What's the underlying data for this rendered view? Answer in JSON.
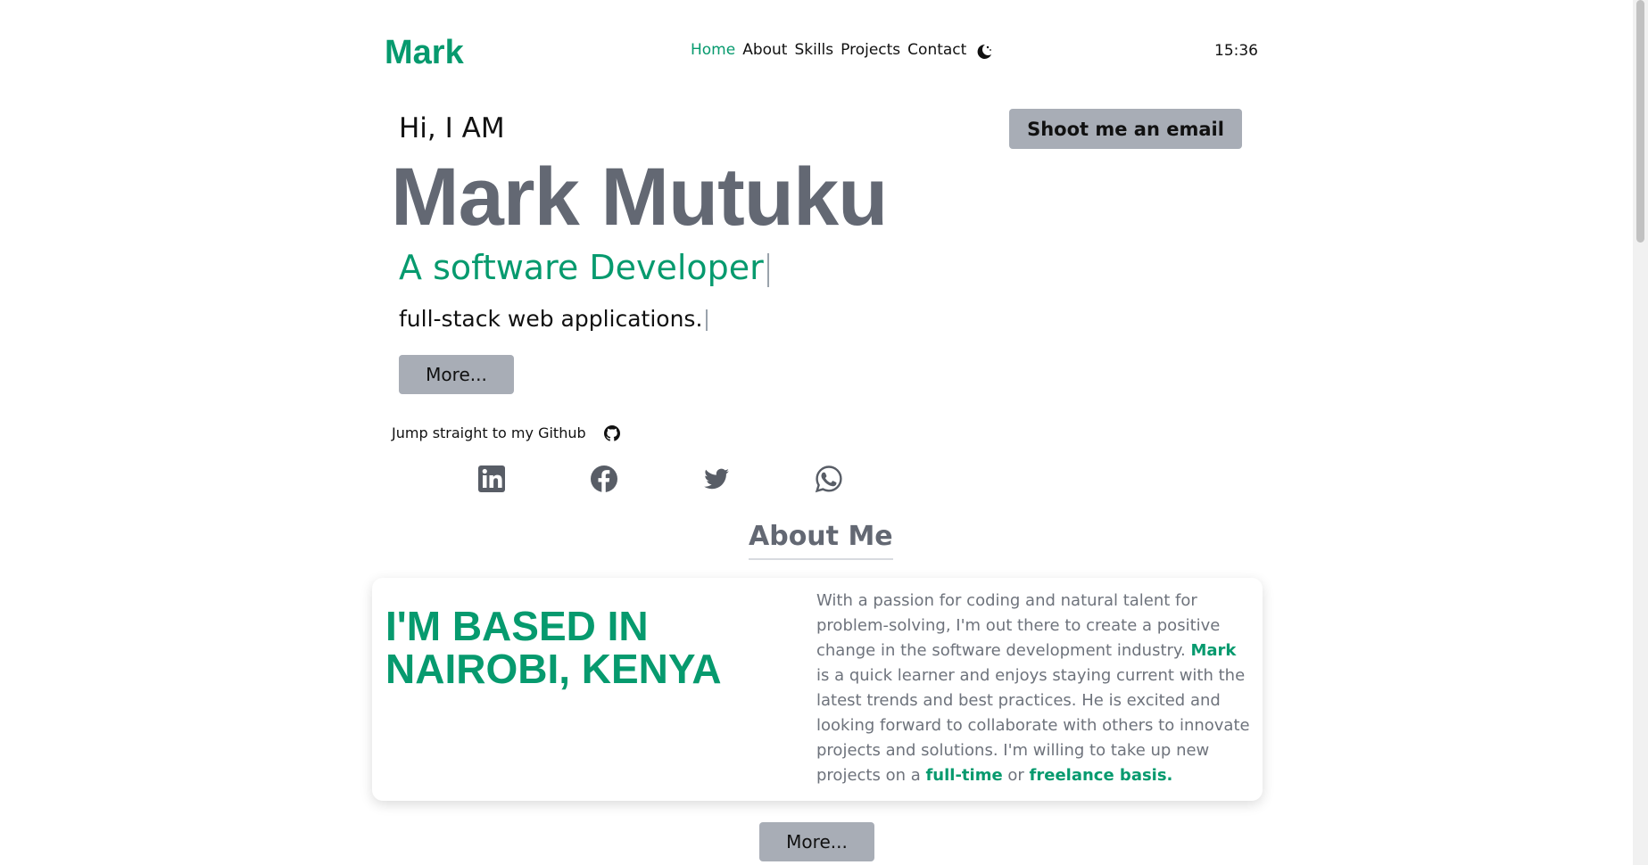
{
  "header": {
    "logo": "Mark",
    "nav": [
      {
        "label": "Home",
        "active": true
      },
      {
        "label": "About",
        "active": false
      },
      {
        "label": "Skills",
        "active": false
      },
      {
        "label": "Projects",
        "active": false
      },
      {
        "label": "Contact",
        "active": false
      }
    ],
    "theme_icon": "moon-icon",
    "clock": "15:36"
  },
  "hero": {
    "greeting": "Hi, I AM",
    "name": "Mark Mutuku",
    "role": "A software Developer",
    "tagline": "full-stack web applications.",
    "more_label": "More...",
    "email_label": "Shoot me an email",
    "github_text": "Jump straight to my Github",
    "github_icon": "github-icon",
    "socials": [
      "linkedin-icon",
      "facebook-icon",
      "twitter-icon",
      "whatsapp-icon"
    ]
  },
  "about": {
    "title": "About Me",
    "based": "I'M BASED IN NAIROBI, KENYA",
    "text_1": "With a passion for coding and natural talent for problem-solving, I'm out there to create a positive change in the software development industry. ",
    "highlight_name": "Mark",
    "text_2": " is a quick learner and enjoys staying current with the latest trends and best practices. He is excited and looking forward to collaborate with others to innovate projects and solutions. I'm willing to take up new projects on a ",
    "highlight_fulltime": "full-time",
    "text_3": " or ",
    "highlight_freelance": "freelance basis.",
    "more_label": "More..."
  },
  "colors": {
    "accent": "#069a6e",
    "name_grey": "#636873",
    "button_grey": "#a8adb6",
    "body_text": "#6e737c"
  }
}
